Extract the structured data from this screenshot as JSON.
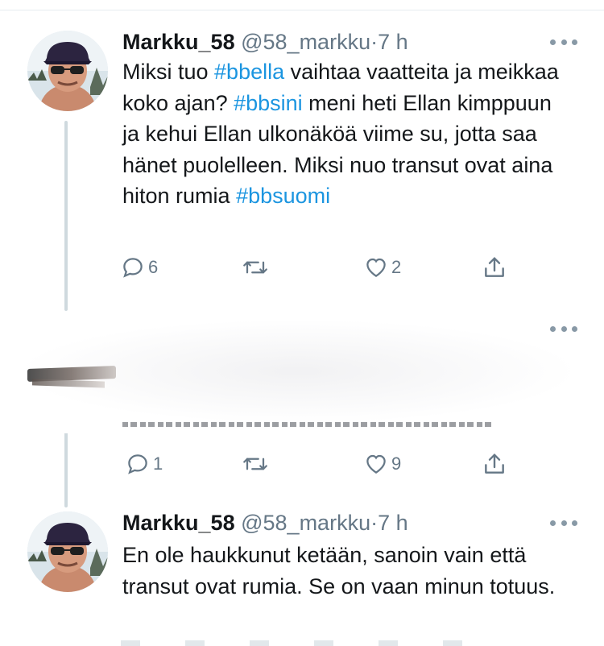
{
  "tweets": [
    {
      "display_name": "Markku_58",
      "handle": "@58_markku",
      "separator": "·",
      "time": "7 h",
      "text_parts": [
        {
          "t": "Miksi tuo "
        },
        {
          "t": "#bbella",
          "hashtag": true
        },
        {
          "t": " vaihtaa vaatteita ja meikkaa koko ajan? "
        },
        {
          "t": "#bbsini",
          "hashtag": true
        },
        {
          "t": " meni heti Ellan kimppuun ja kehui Ellan ulkonäköä viime su, jotta saa hänet puolelleen. Miksi nuo transut ovat aina hiton rumia "
        },
        {
          "t": "#bbsuomi",
          "hashtag": true
        }
      ],
      "replies": "6",
      "retweets": "",
      "likes": "2"
    },
    {
      "display_name": "",
      "handle": "",
      "time": "",
      "replies": "1",
      "retweets": "",
      "likes": "9"
    },
    {
      "display_name": "Markku_58",
      "handle": "@58_markku",
      "separator": "·",
      "time": "7 h",
      "text_parts": [
        {
          "t": "En ole haukkunut ketään, sanoin vain että transut ovat rumia. Se on vaan minun totuus."
        }
      ]
    }
  ],
  "icons": {
    "reply": "reply-icon",
    "retweet": "retweet-icon",
    "like": "heart-icon",
    "share": "share-icon",
    "more": "more-icon"
  },
  "colors": {
    "hashtag": "#1b95e0",
    "secondary": "#657786",
    "text": "#14171a"
  }
}
